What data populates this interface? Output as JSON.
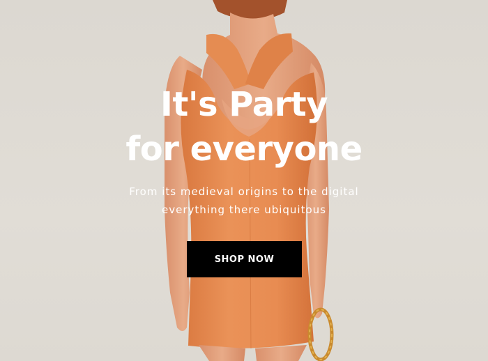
{
  "hero": {
    "title_line1": "It's Party",
    "title_line2": "for everyone",
    "subtitle": "From its medieval origins to the digital everything there ubiquitous",
    "button_label": "SHOP NOW",
    "image": "woman-in-orange-dress-back-view"
  },
  "colors": {
    "background": "#dedad3",
    "dress": "#e58c52",
    "skin": "#e2a27f",
    "hair": "#a3522c",
    "button_bg": "#000000",
    "text": "#ffffff"
  }
}
